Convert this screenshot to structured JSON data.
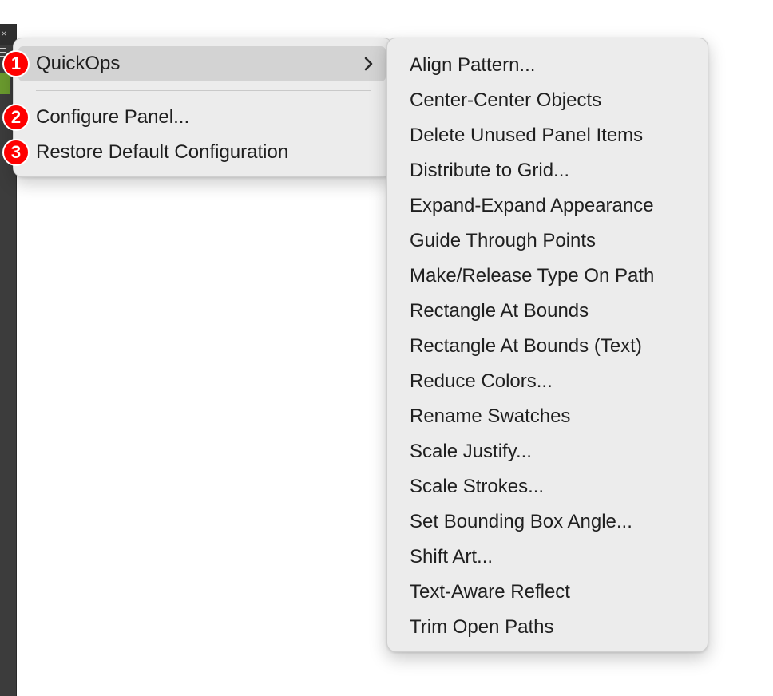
{
  "side_panel": {
    "close_glyph": "×",
    "accent_color": "#6a9a2e"
  },
  "context_menu": {
    "items": [
      {
        "label": "QuickOps",
        "badge": "1",
        "has_submenu": true,
        "highlighted": true
      },
      {
        "label": "Configure Panel...",
        "badge": "2"
      },
      {
        "label": "Restore Default Configuration",
        "badge": "3"
      }
    ],
    "chevron_icon": "chevron-right-icon"
  },
  "submenu": {
    "items": [
      "Align Pattern...",
      "Center-Center Objects",
      "Delete Unused Panel Items",
      "Distribute to Grid...",
      "Expand-Expand Appearance",
      "Guide Through Points",
      "Make/Release Type On Path",
      "Rectangle At Bounds",
      "Rectangle At Bounds (Text)",
      "Reduce Colors...",
      "Rename Swatches",
      "Scale Justify...",
      "Scale Strokes...",
      "Set Bounding Box Angle...",
      "Shift Art...",
      "Text-Aware Reflect",
      "Trim Open Paths"
    ]
  },
  "colors": {
    "menu_bg": "#ececec",
    "highlight": "#d3d3d3",
    "badge": "#ff0000",
    "text": "#1f1f1f"
  }
}
